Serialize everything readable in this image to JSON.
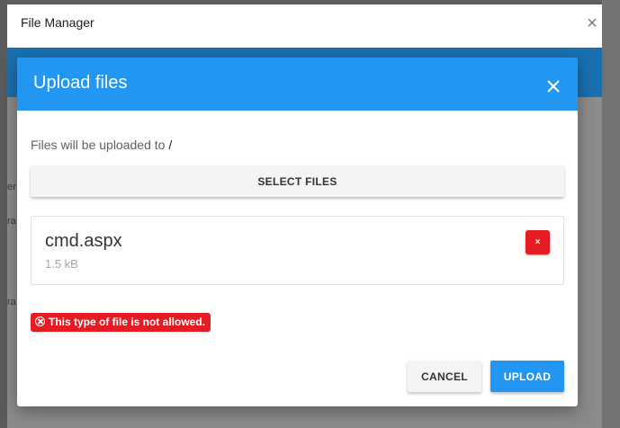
{
  "file_manager": {
    "title": "File Manager",
    "close_icon": "close-icon"
  },
  "backdrop": {
    "ghost_text_1": "er",
    "ghost_text_2": "ra",
    "ghost_text_3": "ra"
  },
  "upload_dialog": {
    "title": "Upload files",
    "close_icon": "close-icon",
    "destination_prefix": "Files will be uploaded to",
    "destination_path": "/",
    "select_files_label": "SELECT FILES",
    "files": [
      {
        "name": "cmd.aspx",
        "size": "1.5 kB",
        "remove_label": "×"
      }
    ],
    "error": {
      "icon": "error-circle-icon",
      "message": "This type of file is not allowed."
    },
    "cancel_label": "CANCEL",
    "upload_label": "UPLOAD"
  },
  "colors": {
    "primary": "#2196f3",
    "danger": "#e51c23",
    "toolbar": "#1a6faf"
  }
}
